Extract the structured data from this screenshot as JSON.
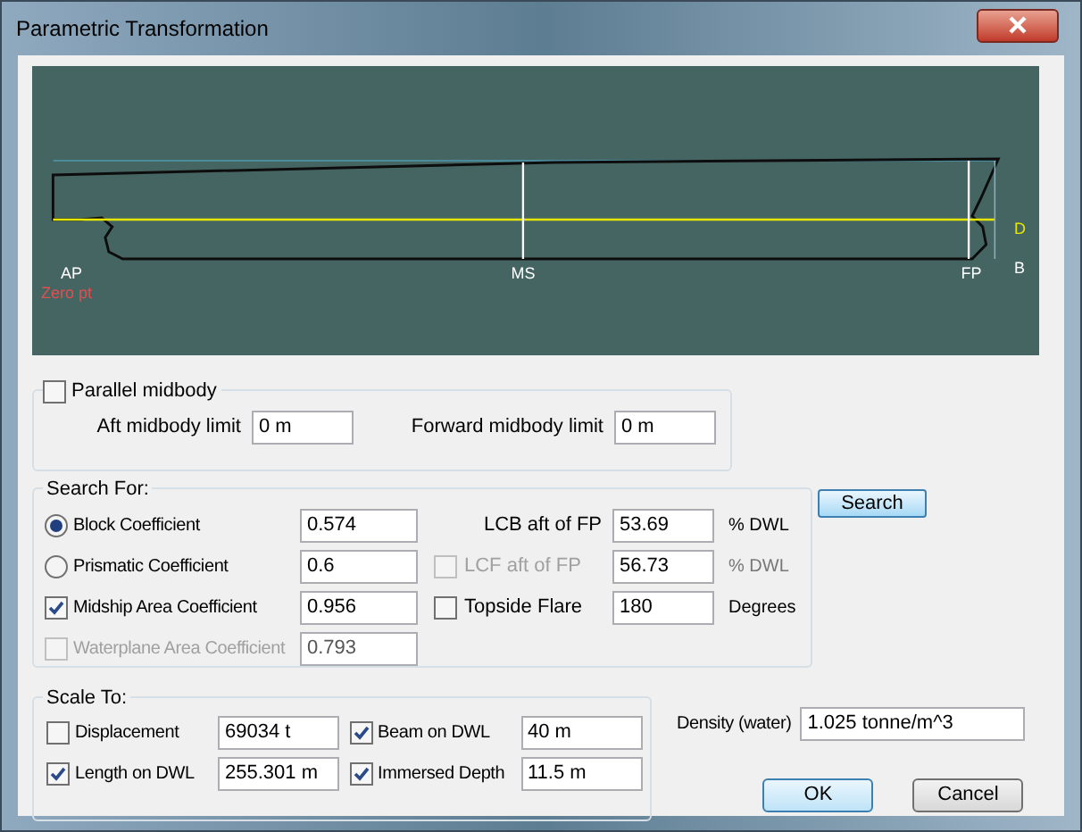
{
  "window": {
    "title": "Parametric Transformation"
  },
  "hull_view": {
    "labels": [
      {
        "kind": "station",
        "text": "AP"
      },
      {
        "kind": "station",
        "text": "MS"
      },
      {
        "kind": "station",
        "text": "FP"
      },
      {
        "kind": "origin",
        "text": "Zero pt"
      },
      {
        "kind": "level",
        "text": "D"
      },
      {
        "kind": "level",
        "text": "B"
      }
    ]
  },
  "parallel_midbody": {
    "label": "Parallel midbody",
    "checked": false,
    "fields": [
      {
        "label": "Aft midbody limit",
        "value": "0 m"
      },
      {
        "label": "Forward midbody limit",
        "value": "0 m"
      }
    ]
  },
  "search_for": {
    "title": "Search For:",
    "left": [
      {
        "kind": "radio",
        "label": "Block Coefficient",
        "selected": true,
        "value": "0.574"
      },
      {
        "kind": "radio",
        "label": "Prismatic Coefficient",
        "selected": false,
        "value": "0.6"
      },
      {
        "kind": "checkbox",
        "label": "Midship Area Coefficient",
        "checked": true,
        "disabled": false,
        "value": "0.956"
      },
      {
        "kind": "checkbox",
        "label": "Waterplane Area Coefficient",
        "checked": false,
        "disabled": true,
        "value": "0.793"
      }
    ],
    "right": [
      {
        "kind": "text",
        "label": "LCB aft of FP",
        "value": "53.69",
        "unit": "% DWL"
      },
      {
        "kind": "checkbox",
        "label": "LCF aft of FP",
        "checked": false,
        "disabled": true,
        "value": "56.73",
        "unit": "% DWL"
      },
      {
        "kind": "checkbox",
        "label": "Topside Flare",
        "checked": false,
        "disabled": false,
        "value": "180",
        "unit": "Degrees"
      }
    ],
    "button": "Search"
  },
  "scale_to": {
    "title": "Scale To:",
    "items": [
      {
        "label": "Displacement",
        "checked": false,
        "value": "69034 t"
      },
      {
        "label": "Beam on DWL",
        "checked": true,
        "value": "40 m"
      },
      {
        "label": "Length on DWL",
        "checked": true,
        "value": "255.301 m"
      },
      {
        "label": "Immersed Depth",
        "checked": true,
        "value": "11.5 m"
      }
    ]
  },
  "density": {
    "label": "Density (water)",
    "value": "1.025 tonne/m^3"
  },
  "buttons": [
    {
      "label": "OK",
      "default": true
    },
    {
      "label": "Cancel",
      "default": false
    }
  ]
}
